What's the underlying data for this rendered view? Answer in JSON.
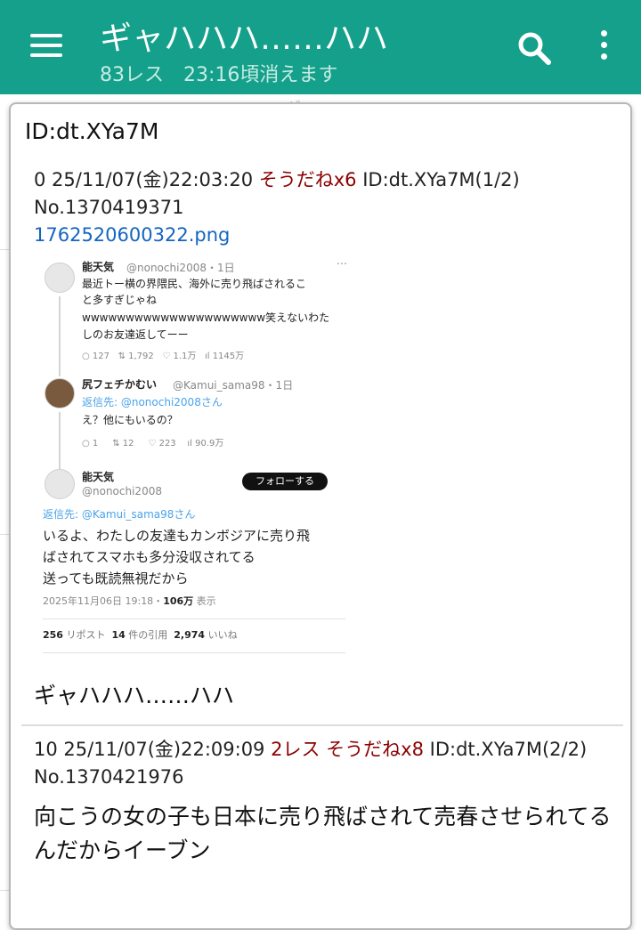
{
  "appbar": {
    "title": "ギャハハハ……ハハ",
    "subtitle": "83レス　23:16頃消えます",
    "icons": {
      "menu": "menu-icon",
      "search": "search-icon",
      "more": "more-vert-icon"
    },
    "color": "#14a08a"
  },
  "background_hint": "ギャハハ……ハハ",
  "panel": {
    "title": "ID:dt.XYa7M"
  },
  "posts": [
    {
      "meta_prefix": "0 25/11/07(金)22:03:20 ",
      "soudane": "そうだねx6",
      "meta_suffix": " ID:dt.XYa7M(1/2)",
      "number": "No.1370419371",
      "file": "1762520600322.png",
      "body": "ギャハハハ……ハハ"
    },
    {
      "meta_prefix": "10 25/11/07(金)22:09:09 ",
      "res_count": "2レス",
      "soudane": "そうだねx8",
      "meta_suffix": " ID:dt.XYa7M(2/2)",
      "number": "No.1370421976",
      "body": "向こうの女の子も日本に売り飛ばされて売春させられてるんだからイーブン"
    }
  ],
  "embedded_image": {
    "tweet1": {
      "name": "能天気",
      "handle": "@nonochi2008・1日",
      "line1": "最近トー横の界隈民、海外に売り飛ばされるこ",
      "line2": "と多すぎじゃね",
      "line3": "wwwwwwwwwwwwwwwwwwwww笑えないわた",
      "line4": "しのお友達返してーー",
      "stats": [
        "127",
        "1,792",
        "1.1万",
        "1145万"
      ]
    },
    "tweet2": {
      "name": "尻フェチかむい",
      "handle": "@Kamui_sama98・1日",
      "reply_to": "返信先: @nonochi2008さん",
      "text": "え？他にもいるの？",
      "stats": [
        "1",
        "12",
        "223",
        "90.9万"
      ]
    },
    "tweet3": {
      "name": "能天気",
      "handle": "@nonochi2008",
      "follow": "フォローする",
      "reply_to": "返信先: @Kamui_sama98さん",
      "line1": "いるよ、わたしの友達もカンボジアに売り飛",
      "line2": "ばされてスマホも多分没収されてる",
      "line3": "送っても既読無視だから",
      "date": "2025年11月06日 19:18・",
      "views": "106万",
      "views_suffix": " 表示",
      "reposts_num": "256",
      "reposts_label": " リポスト",
      "quotes_num": "14",
      "quotes_label": " 件の引用",
      "likes_num": "2,974",
      "likes_label": " いいね"
    }
  }
}
